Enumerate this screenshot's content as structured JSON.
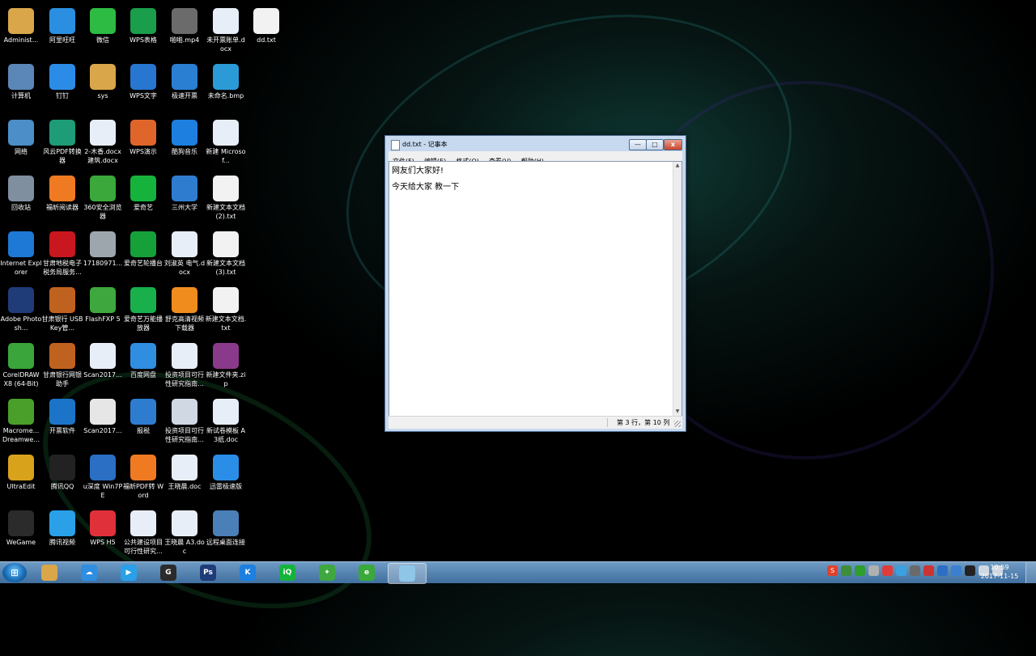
{
  "desktop": {
    "icons": [
      {
        "label": "Administ...",
        "icon": "folder-icon",
        "color": "#d9a64a"
      },
      {
        "label": "阿里旺旺",
        "icon": "aliwangwang-icon",
        "color": "#2a8fe0"
      },
      {
        "label": "微信",
        "icon": "wechat-icon",
        "color": "#2dbb43"
      },
      {
        "label": "WPS表格",
        "icon": "wps-sheet-icon",
        "color": "#1a9e4c"
      },
      {
        "label": "啪啪.mp4",
        "icon": "video-file-icon",
        "color": "#6b6b6b"
      },
      {
        "label": "未开票账单.docx",
        "icon": "word-doc-icon",
        "color": "#e8eef7"
      },
      {
        "label": "dd.txt",
        "icon": "text-file-icon",
        "color": "#f2f2f2"
      },
      {
        "label": "计算机",
        "icon": "computer-icon",
        "color": "#5b86b8"
      },
      {
        "label": "钉钉",
        "icon": "dingtalk-icon",
        "color": "#2b8ce8"
      },
      {
        "label": "sys",
        "icon": "folder-icon",
        "color": "#d9a64a"
      },
      {
        "label": "WPS文字",
        "icon": "wps-writer-icon",
        "color": "#2776d0"
      },
      {
        "label": "极速开票",
        "icon": "invoice-icon",
        "color": "#2a7fd3"
      },
      {
        "label": "未命名.bmp",
        "icon": "image-file-icon",
        "color": "#2b9bd8"
      },
      {
        "label": "网络",
        "icon": "network-icon",
        "color": "#4b8ec8"
      },
      {
        "label": "风云PDF转换器",
        "icon": "pdf-converter-icon",
        "color": "#1e9b77"
      },
      {
        "label": "2-木香.docx 建筑.docx",
        "icon": "word-doc-icon",
        "color": "#e8eef7"
      },
      {
        "label": "WPS演示",
        "icon": "wps-presentation-icon",
        "color": "#e0652b"
      },
      {
        "label": "酷狗音乐",
        "icon": "kugou-icon",
        "color": "#1d7fe0"
      },
      {
        "label": "新建 Microsof...",
        "icon": "word-doc-icon",
        "color": "#e8eef7"
      },
      {
        "label": "回收站",
        "icon": "recycle-bin-icon",
        "color": "#7f8fa0"
      },
      {
        "label": "福昕阅读器",
        "icon": "foxit-reader-icon",
        "color": "#f07a22"
      },
      {
        "label": "360安全浏览器",
        "icon": "browser-360-icon",
        "color": "#3aa83a"
      },
      {
        "label": "爱奇艺",
        "icon": "iqiyi-icon",
        "color": "#16b33c"
      },
      {
        "label": "三州大学",
        "icon": "ie-shortcut-icon",
        "color": "#2e7cd0"
      },
      {
        "label": "新建文本文档 (2).txt",
        "icon": "text-file-icon",
        "color": "#f2f2f2"
      },
      {
        "label": "Internet Explorer",
        "icon": "ie-icon",
        "color": "#1e78d6"
      },
      {
        "label": "甘肃地税电子税务局服务...",
        "icon": "tax-icon",
        "color": "#c8171e"
      },
      {
        "label": "17180971...",
        "icon": "keyboard-file-icon",
        "color": "#9ea6ad"
      },
      {
        "label": "爱奇艺轮播台",
        "icon": "iqiyi-tv-icon",
        "color": "#16a03a"
      },
      {
        "label": "刘淑英 电气.docx",
        "icon": "word-doc-icon",
        "color": "#e8eef7"
      },
      {
        "label": "新建文本文档 (3).txt",
        "icon": "text-file-icon",
        "color": "#f2f2f2"
      },
      {
        "label": "Adobe Photosh...",
        "icon": "photoshop-icon",
        "color": "#1f3c78"
      },
      {
        "label": "甘肃银行 USBKey管...",
        "icon": "bank-icon",
        "color": "#c0621f"
      },
      {
        "label": "FlashFXP 5",
        "icon": "flashfxp-icon",
        "color": "#3ea83e"
      },
      {
        "label": "爱奇艺万能播放器",
        "icon": "iqiyi-player-icon",
        "color": "#19b04c"
      },
      {
        "label": "舒克高清视频下载器",
        "icon": "video-download-icon",
        "color": "#f08c1e"
      },
      {
        "label": "新建文本文档.txt",
        "icon": "text-file-icon",
        "color": "#f2f2f2"
      },
      {
        "label": "CorelDRAW X8 (64-Bit)",
        "icon": "coreldraw-icon",
        "color": "#3aa53a"
      },
      {
        "label": "甘肃银行网银助手",
        "icon": "bank-icon",
        "color": "#c0621f"
      },
      {
        "label": "Scan2017...",
        "icon": "word-doc-icon",
        "color": "#e8eef7"
      },
      {
        "label": "百度网盘",
        "icon": "baidu-netdisk-icon",
        "color": "#2f8ee0"
      },
      {
        "label": "投资项目可行性研究指南...",
        "icon": "word-doc-icon",
        "color": "#e8eef7"
      },
      {
        "label": "新建文件夹.zip",
        "icon": "archive-icon",
        "color": "#8a3a8a"
      },
      {
        "label": "Macrome... Dreamwe...",
        "icon": "dreamweaver-icon",
        "color": "#4a9e2a"
      },
      {
        "label": "开票软件",
        "icon": "invoice-software-icon",
        "color": "#1c74c8"
      },
      {
        "label": "Scan2017...",
        "icon": "scan-image-icon",
        "color": "#e6e6e6"
      },
      {
        "label": "报税",
        "icon": "ie-shortcut-icon",
        "color": "#2e7cd0"
      },
      {
        "label": "投资项目可行性研究指南...",
        "icon": "image-file-icon",
        "color": "#d0d8e4"
      },
      {
        "label": "新试卷模板 A3纸.doc",
        "icon": "word-doc-icon",
        "color": "#e8eef7"
      },
      {
        "label": "UltraEdit",
        "icon": "ultraedit-icon",
        "color": "#d9a21b"
      },
      {
        "label": "腾讯QQ",
        "icon": "qq-icon",
        "color": "#222222"
      },
      {
        "label": "u深度 Win7PE",
        "icon": "usb-tool-icon",
        "color": "#2a6fc4"
      },
      {
        "label": "福昕PDF转 Word",
        "icon": "foxit-pdf-icon",
        "color": "#f07a22"
      },
      {
        "label": "王晓晨.doc",
        "icon": "word-doc-icon",
        "color": "#e8eef7"
      },
      {
        "label": "迅雷极速版",
        "icon": "thunder-icon",
        "color": "#2a8ee8"
      },
      {
        "label": "WeGame",
        "icon": "wegame-icon",
        "color": "#2b2b2b"
      },
      {
        "label": "腾讯视频",
        "icon": "tencent-video-icon",
        "color": "#29a0e8"
      },
      {
        "label": "WPS H5",
        "icon": "wps-h5-icon",
        "color": "#e0303a"
      },
      {
        "label": "公共建设项目可行性研究...",
        "icon": "word-doc-icon",
        "color": "#e8eef7"
      },
      {
        "label": "王晓晨 A3.doc",
        "icon": "word-doc-icon",
        "color": "#e8eef7"
      },
      {
        "label": "远程桌面连接",
        "icon": "remote-desktop-icon",
        "color": "#4a7fb8"
      }
    ]
  },
  "notepad": {
    "title": "dd.txt - 记事本",
    "menu": [
      "文件(F)",
      "编辑(E)",
      "格式(O)",
      "查看(V)",
      "帮助(H)"
    ],
    "lines": [
      "网友们大家好!",
      "今天给大家 教一下"
    ],
    "status": "第 3 行，第 10 列",
    "buttons": {
      "minimize": "—",
      "maximize": "□",
      "close": "x"
    }
  },
  "taskbar": {
    "start_glyph": "⊞",
    "items": [
      {
        "name": "explorer",
        "icon": "folder-icon",
        "color": "#d9a64a",
        "glyph": ""
      },
      {
        "name": "baidu-netdisk",
        "icon": "baidu-netdisk-icon",
        "color": "#2f8ee0",
        "glyph": "☁"
      },
      {
        "name": "tencent-video",
        "icon": "tencent-video-icon",
        "color": "#29a0e8",
        "glyph": "▶"
      },
      {
        "name": "wegame",
        "icon": "wegame-icon",
        "color": "#2b2b2b",
        "glyph": "G"
      },
      {
        "name": "photoshop",
        "icon": "photoshop-icon",
        "color": "#1f3c78",
        "glyph": "Ps"
      },
      {
        "name": "kugou",
        "icon": "kugou-icon",
        "color": "#1d7fe0",
        "glyph": "K"
      },
      {
        "name": "iqiyi",
        "icon": "iqiyi-icon",
        "color": "#16b33c",
        "glyph": "iQ"
      },
      {
        "name": "flashfxp",
        "icon": "flashfxp-icon",
        "color": "#3ea83e",
        "glyph": "✦"
      },
      {
        "name": "360-browser",
        "icon": "browser-360-icon",
        "color": "#3aa83a",
        "glyph": "e"
      },
      {
        "name": "notepad",
        "icon": "notepad-icon",
        "color": "#8fc6e8",
        "glyph": ""
      }
    ],
    "tray": [
      {
        "icon": "sogou-ime-icon",
        "color": "#e2402c",
        "glyph": "S"
      },
      {
        "icon": "tray-icon-1",
        "color": "#3c8d3c",
        "glyph": ""
      },
      {
        "icon": "tray-icon-2",
        "color": "#2e9e2e",
        "glyph": ""
      },
      {
        "icon": "tray-icon-3",
        "color": "#b0b0b0",
        "glyph": ""
      },
      {
        "icon": "tray-icon-4",
        "color": "#e03a3a",
        "glyph": ""
      },
      {
        "icon": "tray-icon-5",
        "color": "#3aa0e0",
        "glyph": ""
      },
      {
        "icon": "tray-icon-6",
        "color": "#6a6a6a",
        "glyph": ""
      },
      {
        "icon": "tray-icon-7",
        "color": "#c33",
        "glyph": ""
      },
      {
        "icon": "tray-icon-8",
        "color": "#2a6fc4",
        "glyph": ""
      },
      {
        "icon": "shield-icon",
        "color": "#3a7fd0",
        "glyph": ""
      },
      {
        "icon": "qq-tray-icon",
        "color": "#222",
        "glyph": ""
      },
      {
        "icon": "network-tray-icon",
        "color": "#cfd8e0",
        "glyph": ""
      },
      {
        "icon": "volume-icon",
        "color": "#cfd8e0",
        "glyph": ""
      }
    ],
    "time": "10:59",
    "date": "2017-11-15"
  }
}
